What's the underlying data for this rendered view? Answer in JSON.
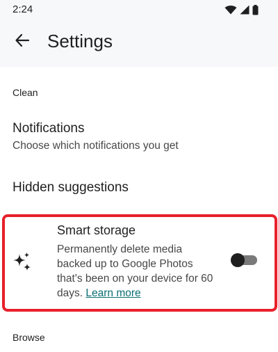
{
  "status_bar": {
    "time": "2:24",
    "icons": [
      "wifi-icon",
      "cell-signal-icon",
      "battery-icon"
    ]
  },
  "app_bar": {
    "back_icon": "arrow-back-icon",
    "title": "Settings"
  },
  "sections": {
    "clean_header": "Clean",
    "browse_header": "Browse"
  },
  "notifications": {
    "title": "Notifications",
    "subtitle": "Choose which notifications you get"
  },
  "hidden_suggestions": {
    "title": "Hidden suggestions"
  },
  "smart_storage": {
    "icon": "sparkle-icon",
    "title": "Smart storage",
    "description": "Permanently delete media backed up to Google Photos that's been on your device for 60 days.",
    "learn_more": "Learn more",
    "enabled": false
  },
  "colors": {
    "highlight": "#e8202a",
    "link": "#0b6e73",
    "header_background": "#f7f8fa"
  }
}
